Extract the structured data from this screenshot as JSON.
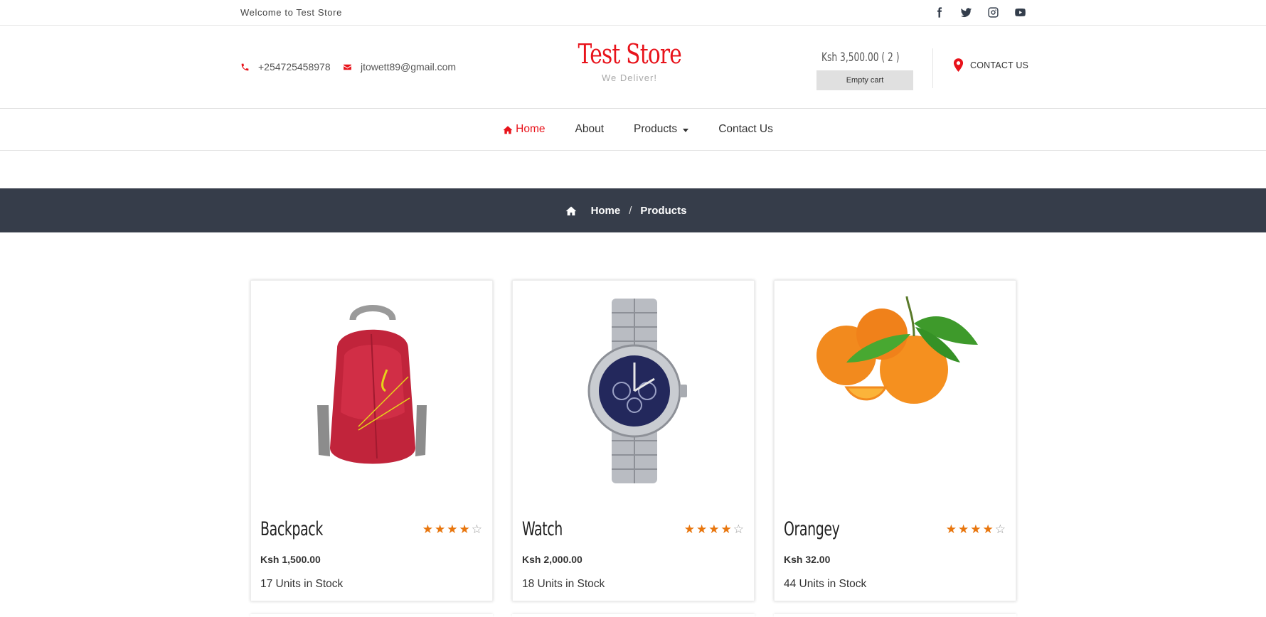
{
  "topbar": {
    "welcome": "Welcome to Test Store",
    "socials": [
      "facebook-icon",
      "twitter-icon",
      "instagram-icon",
      "youtube-icon"
    ]
  },
  "header": {
    "phone": "+254725458978",
    "email": "jtowett89@gmail.com",
    "brand_title": "Test Store",
    "brand_tagline": "We Deliver!",
    "cart_amount": "Ksh 3,500.00 ( 2 )",
    "empty_cart_label": "Empty cart",
    "contact_us": "CONTACT US",
    "accent_color": "#e8131b"
  },
  "nav": {
    "items": [
      {
        "label": "Home",
        "active": true
      },
      {
        "label": "About",
        "active": false
      },
      {
        "label": "Products",
        "active": false,
        "dropdown": true
      },
      {
        "label": "Contact Us",
        "active": false
      }
    ]
  },
  "breadcrumb": {
    "home": "Home",
    "separator": "/",
    "current": "Products",
    "band_color": "#363d4a"
  },
  "products": [
    {
      "name": "Backpack",
      "price": "Ksh 1,500.00",
      "stock": "17 Units in Stock",
      "rating": 4,
      "rating_max": 5,
      "image": "backpack-image"
    },
    {
      "name": "Watch",
      "price": "Ksh 2,000.00",
      "stock": "18 Units in Stock",
      "rating": 4,
      "rating_max": 5,
      "image": "watch-image"
    },
    {
      "name": "Orangey",
      "price": "Ksh 32.00",
      "stock": "44 Units in Stock",
      "rating": 4,
      "rating_max": 5,
      "image": "oranges-image"
    }
  ]
}
